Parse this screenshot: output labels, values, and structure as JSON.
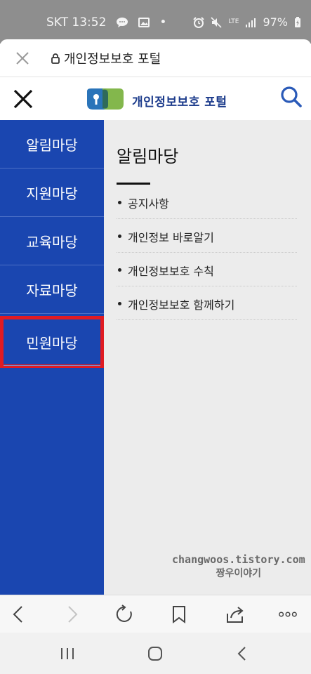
{
  "status_bar": {
    "carrier_time": "SKT 13:52",
    "dot": "•",
    "network": "LTE",
    "battery": "97%",
    "icons": [
      "chat-icon",
      "image-icon",
      "alarm-icon",
      "mute-icon",
      "signal-icon",
      "battery-charging-icon"
    ]
  },
  "browser": {
    "page_title": "개인정보보호 포털",
    "close_icon": "close-icon",
    "lock_icon": "lock-icon"
  },
  "site_header": {
    "logo_text": "개인정보보호 포털",
    "close_icon": "close-icon",
    "search_icon": "search-icon"
  },
  "nav": {
    "items": [
      {
        "label": "알림마당"
      },
      {
        "label": "지원마당"
      },
      {
        "label": "교육마당"
      },
      {
        "label": "자료마당"
      },
      {
        "label": "민원마당",
        "highlighted": true
      }
    ]
  },
  "content": {
    "title": "알림마당",
    "submenu": [
      {
        "label": "공지사항"
      },
      {
        "label": "개인정보 바로알기"
      },
      {
        "label": "개인정보보호 수칙"
      },
      {
        "label": "개인정보보호 함께하기"
      }
    ]
  },
  "watermark": {
    "line1": "changwoos.tistory.com",
    "line2": "짱우이야기"
  },
  "toolbar": {
    "icons": [
      "back-icon",
      "forward-icon",
      "refresh-icon",
      "bookmark-icon",
      "share-icon",
      "more-icon"
    ]
  },
  "nav_bar": {
    "icons": [
      "recent-apps-icon",
      "home-icon",
      "system-back-icon"
    ]
  },
  "colors": {
    "nav_bg": "#1a46b0",
    "highlight": "#e01b22",
    "brand_text": "#1d3c8c",
    "search_icon": "#2a5ab8",
    "content_bg": "#ececec"
  }
}
